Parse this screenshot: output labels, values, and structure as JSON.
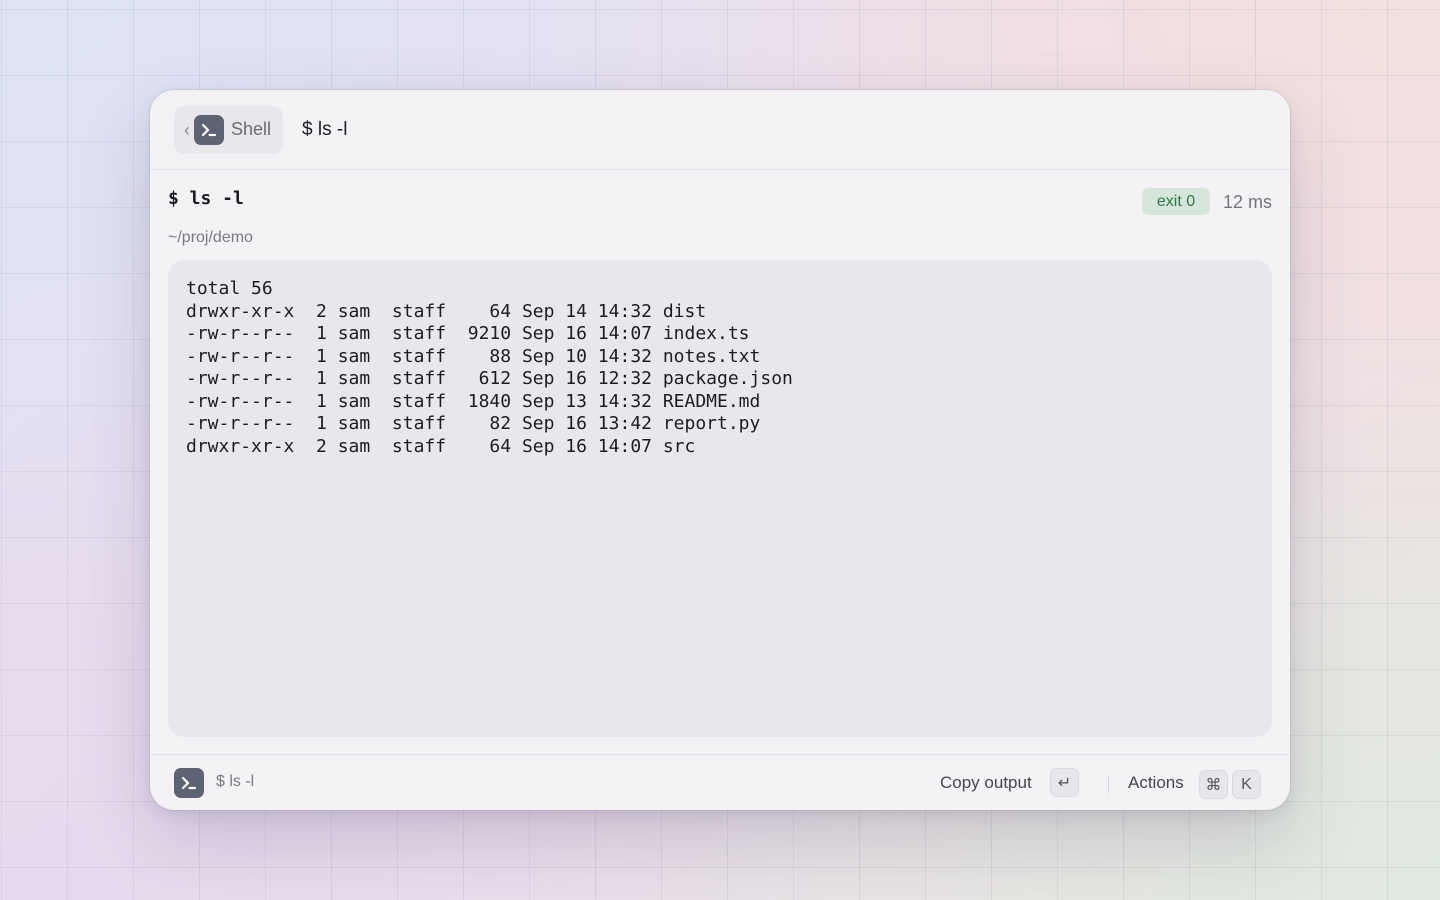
{
  "header": {
    "back_label": "Shell",
    "title": "$ ls -l"
  },
  "command": {
    "text": "$ ls -l",
    "cwd": "~/proj/demo",
    "exit_badge": "exit 0",
    "duration": "12 ms"
  },
  "output": {
    "lines": [
      "total 56",
      "drwxr-xr-x  2 sam  staff    64 Sep 14 14:32 dist",
      "-rw-r--r--  1 sam  staff  9210 Sep 16 14:07 index.ts",
      "-rw-r--r--  1 sam  staff    88 Sep 10 14:32 notes.txt",
      "-rw-r--r--  1 sam  staff   612 Sep 16 12:32 package.json",
      "-rw-r--r--  1 sam  staff  1840 Sep 13 14:32 README.md",
      "-rw-r--r--  1 sam  staff    82 Sep 16 13:42 report.py",
      "drwxr-xr-x  2 sam  staff    64 Sep 16 14:07 src"
    ]
  },
  "footer": {
    "command": "$ ls -l",
    "copy_label": "Copy output",
    "copy_key": "↵",
    "actions_label": "Actions",
    "actions_keys": [
      "⌘",
      "K"
    ]
  },
  "colors": {
    "accent_icon": "#5d6372",
    "exit_badge_bg": "#d6e6dc",
    "exit_badge_text": "#2f7a43"
  },
  "icons": {
    "app": "terminal-prompt-icon",
    "back": "chevron-left-icon"
  }
}
